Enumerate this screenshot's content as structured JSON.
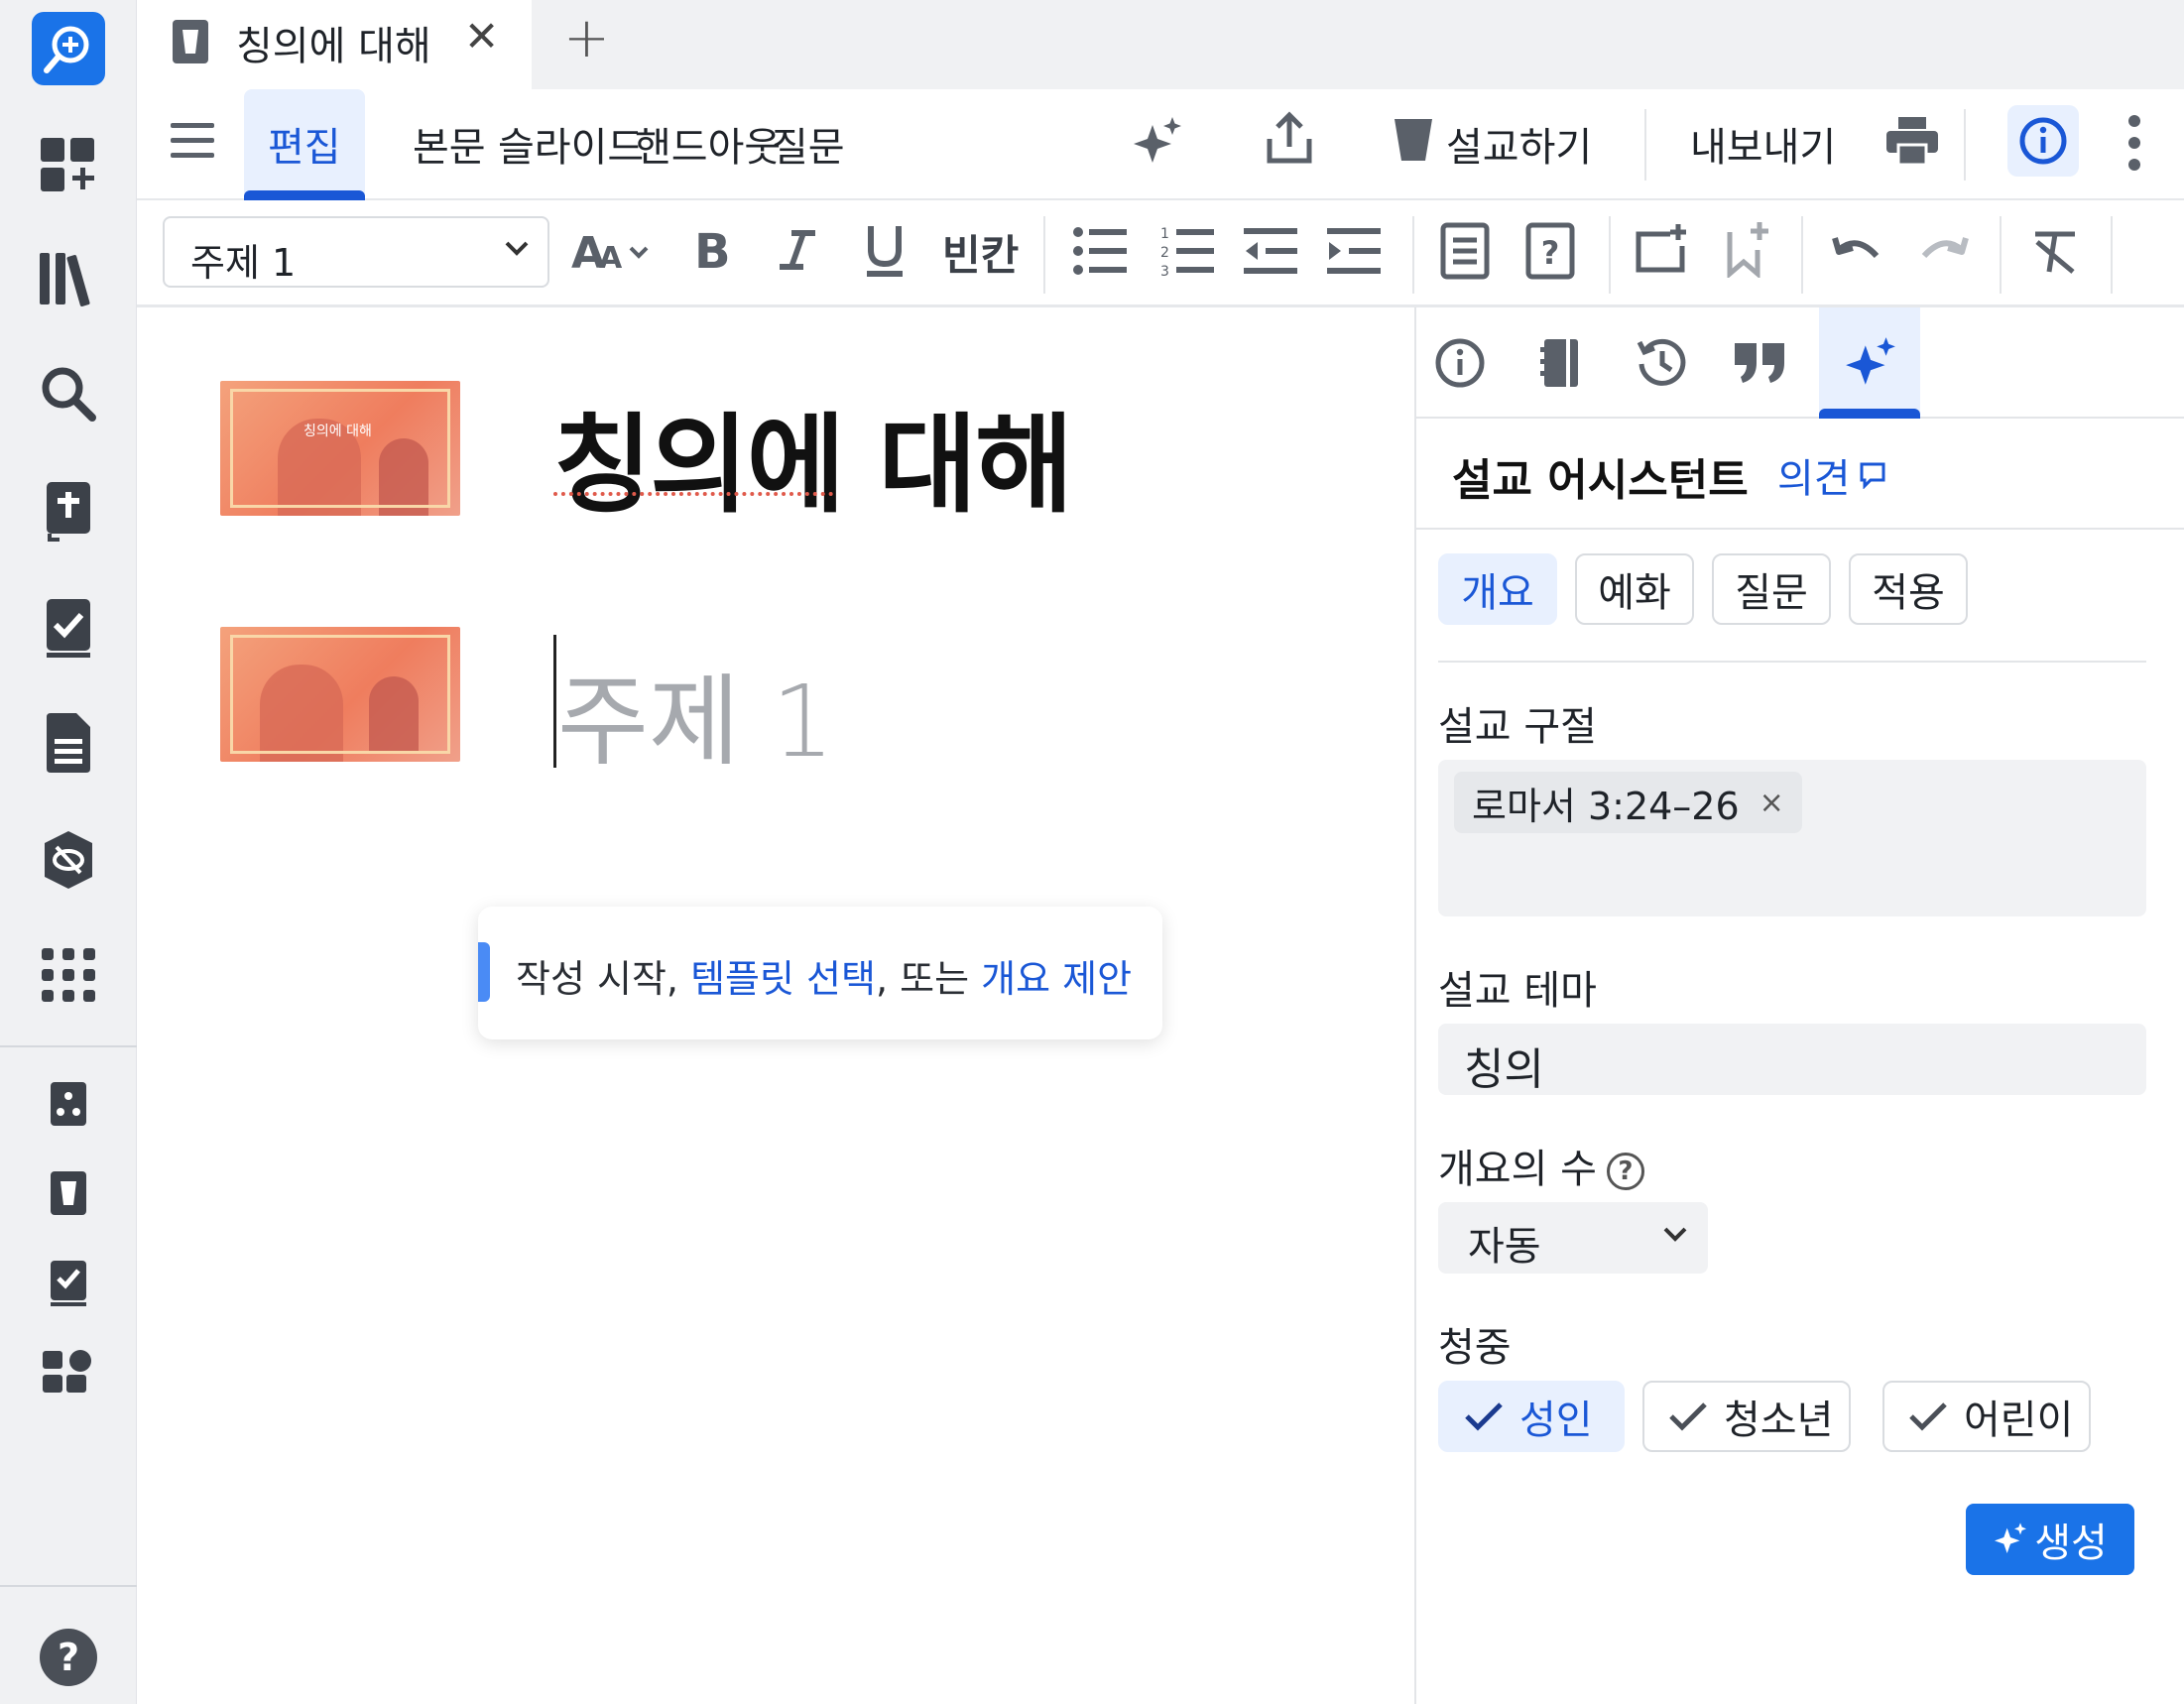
{
  "tab": {
    "title": "칭의에 대해",
    "close": "✕",
    "add": "+"
  },
  "menu": {
    "items": [
      "편집",
      "본문",
      "슬라이드",
      "핸드아웃",
      "질문"
    ],
    "preach": "설교하기",
    "export": "내보내기"
  },
  "toolbar": {
    "style_value": "주제 1",
    "blank_label": "빈칸"
  },
  "editor": {
    "heading": "칭의에 대해",
    "subheading_placeholder": "주제 1",
    "thumbnail_caption": "칭의에 대해",
    "hint_prefix": "작성 시작, ",
    "hint_template": "템플릿 선택",
    "hint_middle": ", 또는 ",
    "hint_outline": "개요 제안"
  },
  "panel": {
    "title": "설교 어시스턴트",
    "feedback": "의견",
    "segments": [
      "개요",
      "예화",
      "질문",
      "적용"
    ],
    "passage_label": "설교 구절",
    "passage_chip": "로마서 3:24–26",
    "passage_chip_remove": "×",
    "theme_label": "설교 테마",
    "theme_value": "칭의",
    "count_label": "개요의 수",
    "count_value": "자동",
    "audience_label": "청중",
    "audiences": [
      "성인",
      "청소년",
      "어린이"
    ],
    "generate": "생성"
  },
  "colors": {
    "accent": "#1a73e8",
    "accent_dark": "#1a57d6",
    "active_bg": "#e8f0fe"
  }
}
